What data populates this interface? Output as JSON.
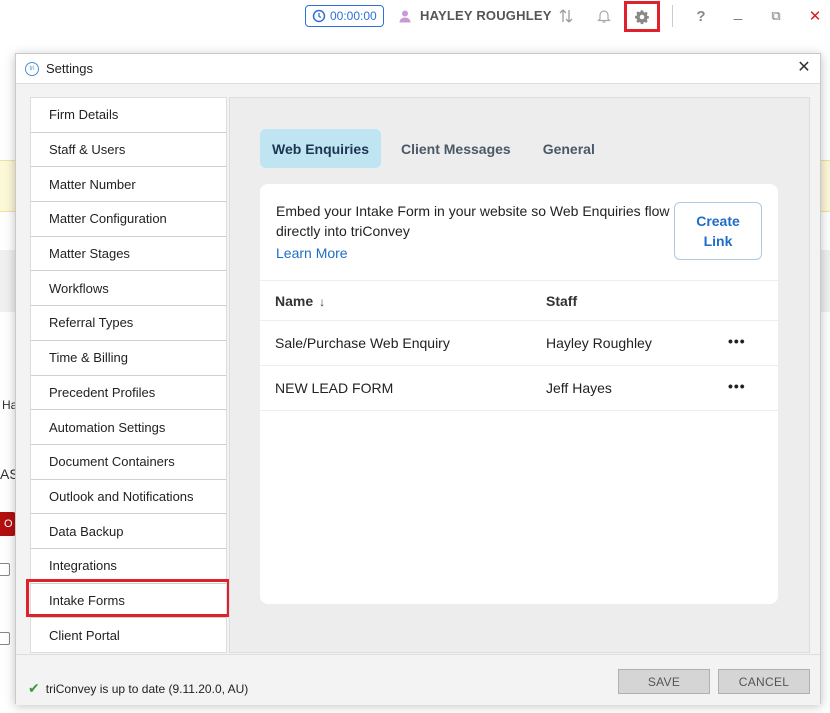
{
  "topbar": {
    "timer": "00:00:00",
    "user_name": "HAYLEY ROUGHLEY",
    "icons": [
      "sync-icon",
      "bell-icon",
      "gear-icon",
      "help-icon",
      "minimize-icon",
      "restore-icon",
      "close-icon"
    ],
    "help_glyph": "?",
    "minimize_glyph": "_",
    "restore_glyph": "⧉",
    "close_glyph": "✕"
  },
  "background": {
    "left_text_1": "Ha",
    "left_text_2": "AS",
    "left_text_3": "O"
  },
  "dialog": {
    "title": "Settings",
    "logo_text": "tri",
    "close_glyph": "✕"
  },
  "sidebar": {
    "items": [
      {
        "label": "Firm Details"
      },
      {
        "label": "Staff & Users"
      },
      {
        "label": "Matter Number"
      },
      {
        "label": "Matter Configuration"
      },
      {
        "label": "Matter Stages"
      },
      {
        "label": "Workflows"
      },
      {
        "label": "Referral Types"
      },
      {
        "label": "Time & Billing"
      },
      {
        "label": "Precedent Profiles"
      },
      {
        "label": "Automation Settings"
      },
      {
        "label": "Document Containers"
      },
      {
        "label": "Outlook and Notifications"
      },
      {
        "label": "Data Backup"
      },
      {
        "label": "Integrations"
      },
      {
        "label": "Intake Forms"
      },
      {
        "label": "Client Portal"
      }
    ],
    "selected": "Intake Forms"
  },
  "main": {
    "tabs": [
      {
        "label": "Web Enquiries",
        "active": true
      },
      {
        "label": "Client Messages",
        "active": false
      },
      {
        "label": "General",
        "active": false
      }
    ],
    "embed_text": "Embed your Intake Form in your website so Web Enquiries flow directly into triConvey",
    "learn_more": "Learn More",
    "create_link_line1": "Create",
    "create_link_line2": "Link",
    "table": {
      "columns": {
        "name": "Name",
        "sort_icon": "↓",
        "staff": "Staff"
      },
      "rows": [
        {
          "name": "Sale/Purchase Web Enquiry",
          "staff": "Hayley Roughley",
          "menu": "•••"
        },
        {
          "name": "NEW LEAD FORM",
          "staff": "Jeff Hayes",
          "menu": "•••"
        }
      ]
    }
  },
  "footer": {
    "status": "triConvey is up to date (9.11.20.0, AU)",
    "check_glyph": "✔",
    "save": "SAVE",
    "cancel": "CANCEL"
  },
  "colors": {
    "accent": "#1f6dc6",
    "active_tab_bg": "#bfe4f2",
    "highlight_red": "#e0202b"
  }
}
